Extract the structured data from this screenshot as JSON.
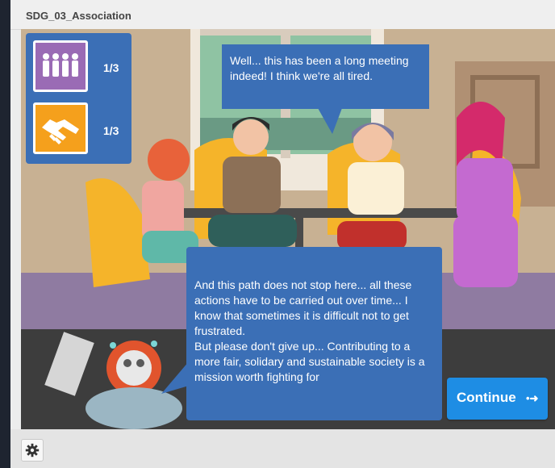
{
  "window": {
    "title": "SDG_03_Association"
  },
  "stats": [
    {
      "icon": "people-group-icon",
      "value": "1/3",
      "color": "#9a6bb5"
    },
    {
      "icon": "handshake-icon",
      "value": "1/3",
      "color": "#f5a01c"
    }
  ],
  "dialogue": {
    "top_bubble": "Well... this has been a long meeting indeed! I think we're all tired.",
    "bottom_bubble_p1": "And this path does not stop here... all these actions have to be carried out over time... I know that sometimes it is difficult not to get frustrated.",
    "bottom_bubble_p2": "But please don't give up... Contributing to a more fair, solidary and sustainable society is a mission worth fighting for"
  },
  "continue_button": {
    "label": "Continue",
    "icon": "arrow-right-icon"
  },
  "footer": {
    "settings_icon": "gear-icon"
  },
  "colors": {
    "panel_blue": "#3b6fb6",
    "button_blue": "#1e8de4",
    "stat_purple": "#9a6bb5",
    "stat_orange": "#f5a01c"
  }
}
